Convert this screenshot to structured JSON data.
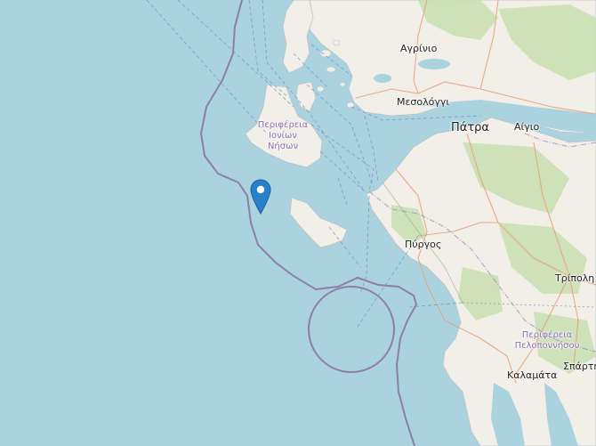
{
  "labels": {
    "agrinio": "Αγρίνιο",
    "mesolongi": "Μεσολόγγι",
    "patra": "Πάτρα",
    "aigio": "Αίγιο",
    "pyrgos": "Πύργος",
    "tripoli": "Τρίπολη",
    "kalamata": "Καλαμάτα",
    "sparti": "Σπάρτη",
    "ionian_region": [
      "Περιφέρεια",
      "Ιονίων",
      "Νήσων"
    ],
    "peloponnese_region": [
      "Περιφέρεια",
      "Πελοποννήσου"
    ]
  },
  "colors": {
    "sea": "#aad3df",
    "land": "#f2efe9",
    "forest": "#c8dfb0",
    "boundary": "#8e7ea8",
    "ferry": "#6f8fc4",
    "road": "#e8a37a",
    "marker": "#2a81cb"
  },
  "marker": {
    "icon": "map-pin-icon"
  }
}
